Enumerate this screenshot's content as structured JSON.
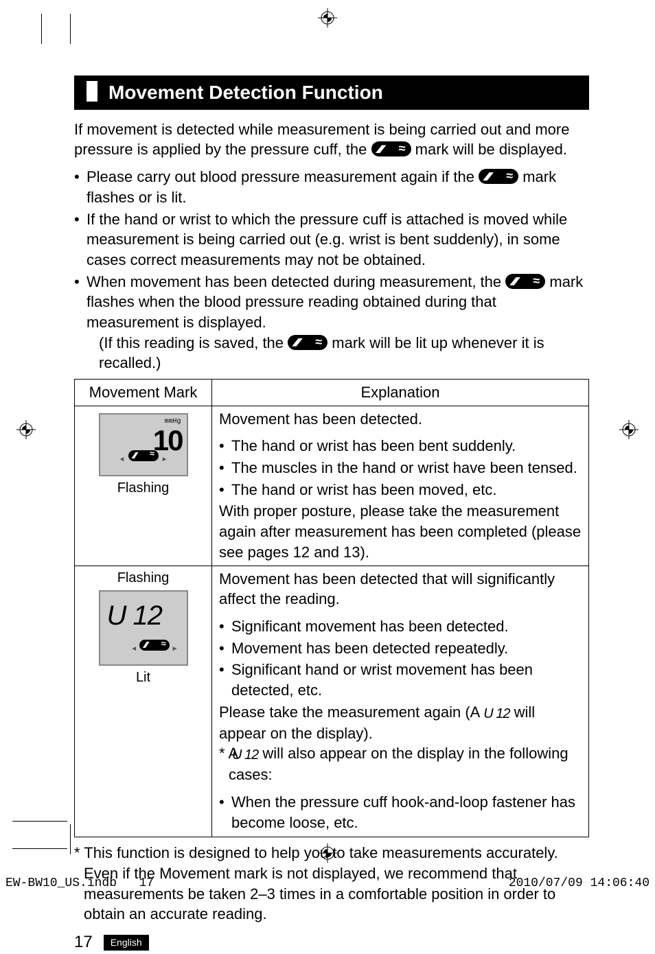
{
  "heading": "Movement Detection Function",
  "intro_a": "If movement is detected while measurement is being carried out and more pressure is applied by the pressure cuff, the ",
  "intro_b": " mark will be displayed.",
  "bullets": {
    "b1a": "Please carry out blood pressure measurement again if the ",
    "b1b": " mark flashes or is lit.",
    "b2": "If the hand or wrist to which the pressure cuff is attached is moved while measurement is being carried out (e.g. wrist is bent suddenly), in some cases correct measurements may not be obtained.",
    "b3a": "When movement has been detected during measurement, the ",
    "b3b": " mark flashes when the blood pressure reading obtained during that measurement is displayed.",
    "b3c": "(If this reading is saved, the ",
    "b3d": " mark will be lit up whenever it is recalled.)"
  },
  "table": {
    "h1": "Movement Mark",
    "h2": "Explanation",
    "r1_label": "Flashing",
    "r1_lcd_mmhg": "mmHg",
    "r1_lcd_val": "10",
    "r1": {
      "line1": "Movement has been detected.",
      "li1": "The hand or wrist has been bent suddenly.",
      "li2": "The muscles in the hand or wrist have been tensed.",
      "li3": "The hand or wrist has been moved, etc.",
      "line2": "With proper posture, please take the measurement again after measurement has been completed (please see pages 12 and 13)."
    },
    "r2_label_top": "Flashing",
    "r2_label_bot": "Lit",
    "r2_lcd_val": "U 12",
    "r2": {
      "line1": "Movement has been detected that will significantly affect the reading.",
      "li1": "Significant movement has been detected.",
      "li2": "Movement has been detected repeatedly.",
      "li3": "Significant hand or wrist movement has been detected, etc.",
      "line2a": "Please take the measurement again (A ",
      "line2b": " will appear on the display).",
      "star_a": "* A ",
      "star_b": " will also appear on the display in the following cases:",
      "li4": "When the pressure cuff hook-and-loop fastener has become loose, etc."
    }
  },
  "u12_glyph": "U 12",
  "footnote": "* This function is designed to help you to take measurements accurately. Even if the Movement mark is not displayed, we recommend that measurements be taken 2–3 times in a comfortable position in order to obtain an accurate reading.",
  "page_number": "17",
  "language": "English",
  "imprint": {
    "file": "EW-BW10_US.indb",
    "page": "17",
    "datetime": "2010/07/09   14:06:40"
  }
}
